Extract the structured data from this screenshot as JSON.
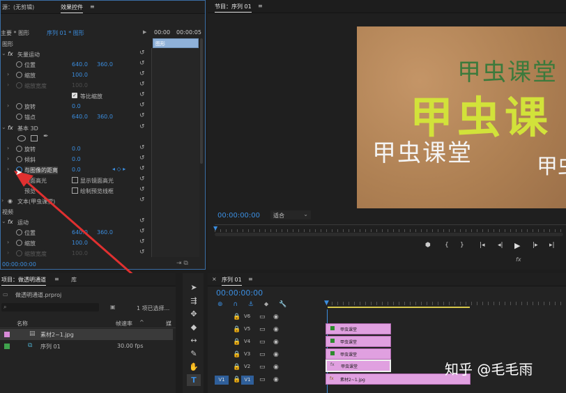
{
  "source_tab": "源：(无剪辑)",
  "effect_controls": {
    "tab_label": "效果控件",
    "master_label": "主要 * 图形",
    "sequence_label": "序列 01 * 图形",
    "time_marker_a": "00:00",
    "time_marker_b": "00:00:05",
    "clip_bar_label": "图形",
    "section_graphics": "图形",
    "vector_motion": "矢量运动",
    "position_label": "位置",
    "position_x": "640.0",
    "position_y": "360.0",
    "scale_label": "缩放",
    "scale_value": "100.0",
    "scale_width_label": "缩放宽度",
    "scale_width_value": "100.0",
    "uniform_scale_label": "等比缩放",
    "rotation_label": "旋转",
    "rotation_value": "0.0",
    "anchor_label": "锚点",
    "anchor_x": "640.0",
    "anchor_y": "360.0",
    "basic3d": "基本 3D",
    "swivel_label": "旋转",
    "swivel_value": "0.0",
    "tilt_label": "倾斜",
    "tilt_value": "0.0",
    "distance_label": "与图像的距离",
    "distance_value": "0.0",
    "specular_label": "镜面高光",
    "show_specular_label": "显示镜面高光",
    "preview_label": "预览",
    "draw_preview_label": "绘制预览线框",
    "text_layer": "文本(甲虫课堂)",
    "section_video": "视频",
    "motion": "运动",
    "v_position_label": "位置",
    "v_position_x": "640.0",
    "v_position_y": "360.0",
    "v_scale_label": "缩放",
    "v_scale_value": "100.0",
    "v_scale_width_label": "缩放宽度",
    "v_scale_width_value": "100.0",
    "bottom_time": "00:00:00:00"
  },
  "program": {
    "tab_label": "节目：序列 01",
    "timecode": "00:00:00:00",
    "fit_label": "适合",
    "fx_label": "fx",
    "preview_text_top": "甲虫课堂",
    "preview_text_big": "甲虫课",
    "preview_text_left": "甲虫课堂",
    "preview_text_right": "甲虫"
  },
  "project": {
    "tab_label": "项目：做透明通道",
    "tab2_label": "库",
    "project_file": "做透明通道.prproj",
    "selection_info": "1 项已选择...",
    "col_name": "名称",
    "col_fps": "帧速率",
    "col_media": "媒",
    "items": [
      {
        "name": "素材2~1.jpg",
        "fps": ""
      },
      {
        "name": "序列 01",
        "fps": "30.00 fps"
      }
    ],
    "label_colors": [
      "#d88ad8",
      "#3fa34d"
    ]
  },
  "timeline": {
    "tab_label": "序列 01",
    "timecode": "00:00:00:00",
    "tracks": [
      "V6",
      "V5",
      "V4",
      "V3",
      "V2",
      "V1"
    ],
    "source_patch": "V1",
    "clips": [
      {
        "label": "甲虫课堂"
      },
      {
        "label": "甲虫课堂"
      },
      {
        "label": "甲虫课堂"
      },
      {
        "label": "甲虫课堂"
      },
      {
        "label": "素材2~1.jpg"
      }
    ]
  },
  "watermark": "知乎 @毛毛雨",
  "colors": {
    "accent_blue": "#3b8ee0",
    "clip_pink": "#e0a0e0",
    "arrow_red": "#e03030",
    "title_green": "#3c7a3c",
    "title_yellow": "#d2e23a"
  }
}
